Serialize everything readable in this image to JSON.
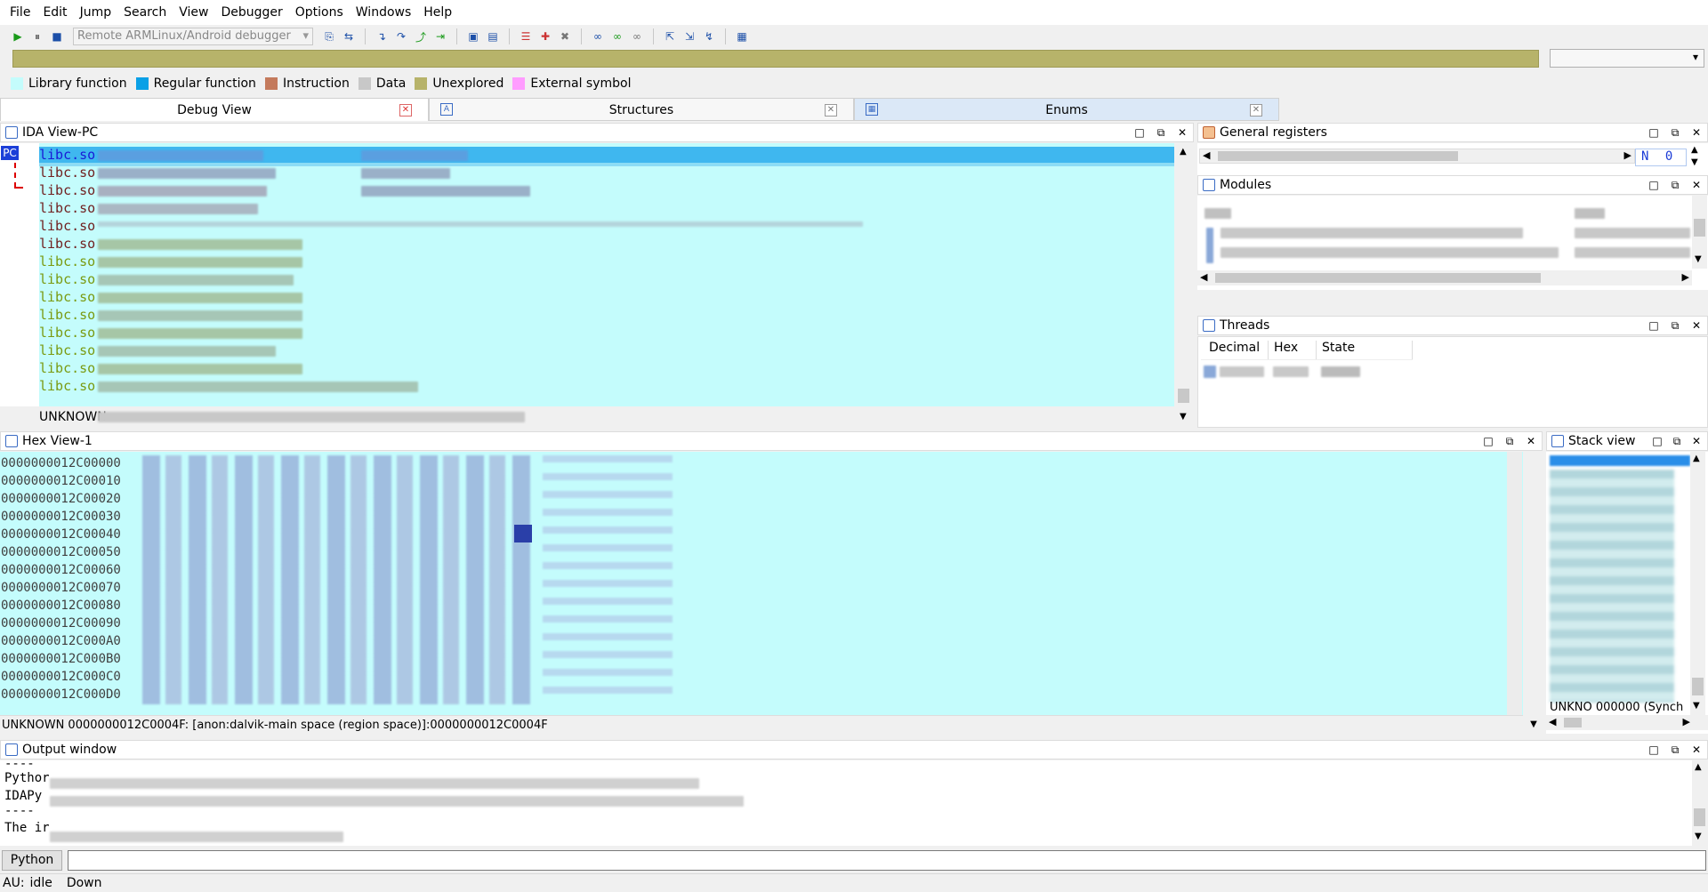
{
  "menu": [
    "File",
    "Edit",
    "Jump",
    "Search",
    "View",
    "Debugger",
    "Options",
    "Windows",
    "Help"
  ],
  "toolbar": {
    "debugger_select": "Remote ARMLinux/Android debugger"
  },
  "legend": [
    {
      "label": "Library function",
      "color": "#c4fcfc"
    },
    {
      "label": "Regular function",
      "color": "#0aa0e6"
    },
    {
      "label": "Instruction",
      "color": "#c47a5c"
    },
    {
      "label": "Data",
      "color": "#c8c8c8"
    },
    {
      "label": "Unexplored",
      "color": "#b7b36a"
    },
    {
      "label": "External symbol",
      "color": "#ff9cff"
    }
  ],
  "tabs": [
    {
      "label": "Debug View",
      "active": true
    },
    {
      "label": "Structures",
      "active": false
    },
    {
      "label": "Enums",
      "active": false
    }
  ],
  "ida_view": {
    "title": "IDA View-PC",
    "pc_label": "PC",
    "rows": [
      "libc.so",
      "libc.so",
      "libc.so",
      "libc.so",
      "libc.so",
      "libc.so",
      "libc.so",
      "libc.so",
      "libc.so",
      "libc.so",
      "libc.so",
      "libc.so",
      "libc.so",
      "libc.so"
    ],
    "footer": "UNKNOWN"
  },
  "general_registers": {
    "title": "General registers",
    "flag_n": "N",
    "flag_val": "0"
  },
  "modules": {
    "title": "Modules"
  },
  "threads": {
    "title": "Threads",
    "columns": [
      "Decimal",
      "Hex",
      "State"
    ]
  },
  "hex_view": {
    "title": "Hex View-1",
    "addresses": [
      "0000000012C00000",
      "0000000012C00010",
      "0000000012C00020",
      "0000000012C00030",
      "0000000012C00040",
      "0000000012C00050",
      "0000000012C00060",
      "0000000012C00070",
      "0000000012C00080",
      "0000000012C00090",
      "0000000012C000A0",
      "0000000012C000B0",
      "0000000012C000C0",
      "0000000012C000D0"
    ],
    "status": "UNKNOWN 0000000012C0004F: [anon:dalvik-main space (region space)]:0000000012C0004F"
  },
  "stack_view": {
    "title": "Stack view",
    "footer": "UNKNO 000000 (Synch"
  },
  "output": {
    "title": "Output window",
    "lines": [
      "----",
      "Pythor",
      "IDAPy",
      "----",
      "The ir"
    ],
    "lang_button": "Python"
  },
  "status": {
    "au": "AU:",
    "state": "idle",
    "dir": "Down"
  }
}
